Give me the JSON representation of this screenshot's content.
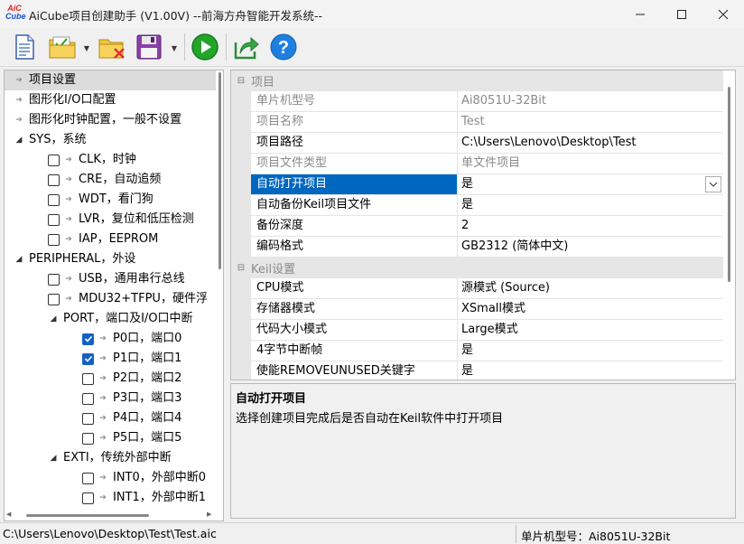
{
  "window": {
    "logo_line1": "AiC",
    "logo_line2": "Cube",
    "title": "AiCube项目创建助手 (V1.00V) --前海方舟智能开发系统--"
  },
  "toolbar": {
    "buttons": [
      {
        "name": "new-project-button",
        "icon": "new-document-icon"
      },
      {
        "name": "open-project-button",
        "icon": "open-folder-icon"
      },
      {
        "name": "close-project-button",
        "icon": "close-folder-icon"
      },
      {
        "name": "save-project-button",
        "icon": "save-icon"
      },
      {
        "name": "run-button",
        "icon": "play-icon"
      },
      {
        "name": "export-button",
        "icon": "share-icon"
      },
      {
        "name": "help-button",
        "icon": "help-icon"
      }
    ]
  },
  "tree": {
    "items": [
      {
        "label": "项目设置",
        "level": 0,
        "type": "arrow",
        "selected": true
      },
      {
        "label": "图形化I/O口配置",
        "level": 0,
        "type": "arrow"
      },
      {
        "label": "图形化时钟配置，一般不设置",
        "level": 0,
        "type": "arrow"
      },
      {
        "label": "SYS，系统",
        "level": 0,
        "type": "expand"
      },
      {
        "label": "CLK，时钟",
        "level": 1,
        "type": "check",
        "checked": false
      },
      {
        "label": "CRE，自动追频",
        "level": 1,
        "type": "check",
        "checked": false
      },
      {
        "label": "WDT，看门狗",
        "level": 1,
        "type": "check",
        "checked": false
      },
      {
        "label": "LVR，复位和低压检测",
        "level": 1,
        "type": "check",
        "checked": false
      },
      {
        "label": "IAP，EEPROM",
        "level": 1,
        "type": "check",
        "checked": false
      },
      {
        "label": "PERIPHERAL，外设",
        "level": 0,
        "type": "expand"
      },
      {
        "label": "USB，通用串行总线",
        "level": 1,
        "type": "check",
        "checked": false
      },
      {
        "label": "MDU32+TFPU，硬件浮",
        "level": 1,
        "type": "check",
        "checked": false
      },
      {
        "label": "PORT，端口及I/O口中断",
        "level": 1,
        "type": "expand"
      },
      {
        "label": "P0口，端口0",
        "level": 2,
        "type": "check",
        "checked": true
      },
      {
        "label": "P1口，端口1",
        "level": 2,
        "type": "check",
        "checked": true
      },
      {
        "label": "P2口，端口2",
        "level": 2,
        "type": "check",
        "checked": false
      },
      {
        "label": "P3口，端口3",
        "level": 2,
        "type": "check",
        "checked": false
      },
      {
        "label": "P4口，端口4",
        "level": 2,
        "type": "check",
        "checked": false
      },
      {
        "label": "P5口，端口5",
        "level": 2,
        "type": "check",
        "checked": false
      },
      {
        "label": "EXTI，传统外部中断",
        "level": 1,
        "type": "expand"
      },
      {
        "label": "INT0，外部中断0",
        "level": 2,
        "type": "check",
        "checked": false
      },
      {
        "label": "INT1，外部中断1",
        "level": 2,
        "type": "check",
        "checked": false
      }
    ]
  },
  "properties": {
    "categories": [
      {
        "name": "项目",
        "rows": [
          {
            "name": "单片机型号",
            "value": "Ai8051U-32Bit",
            "readonly": true
          },
          {
            "name": "项目名称",
            "value": "Test",
            "readonly": true
          },
          {
            "name": "项目路径",
            "value": "C:\\Users\\Lenovo\\Desktop\\Test"
          },
          {
            "name": "项目文件类型",
            "value": "单文件项目",
            "readonly": true
          },
          {
            "name": "自动打开项目",
            "value": "是",
            "active": true
          },
          {
            "name": "自动备份Keil项目文件",
            "value": "是"
          },
          {
            "name": "备份深度",
            "value": "2"
          },
          {
            "name": "编码格式",
            "value": "GB2312 (简体中文)"
          }
        ]
      },
      {
        "name": "Keil设置",
        "rows": [
          {
            "name": "CPU模式",
            "value": "源模式 (Source)"
          },
          {
            "name": "存储器模式",
            "value": "XSmall模式"
          },
          {
            "name": "代码大小模式",
            "value": "Large模式"
          },
          {
            "name": "4字节中断帧",
            "value": "是"
          },
          {
            "name": "使能REMOVEUNUSED关键字",
            "value": "是"
          }
        ]
      }
    ]
  },
  "description": {
    "title": "自动打开项目",
    "text": "选择创建项目完成后是否自动在Keil软件中打开项目"
  },
  "status": {
    "path": "C:\\Users\\Lenovo\\Desktop\\Test\\Test.aic",
    "model": "单片机型号：Ai8051U-32Bit"
  }
}
